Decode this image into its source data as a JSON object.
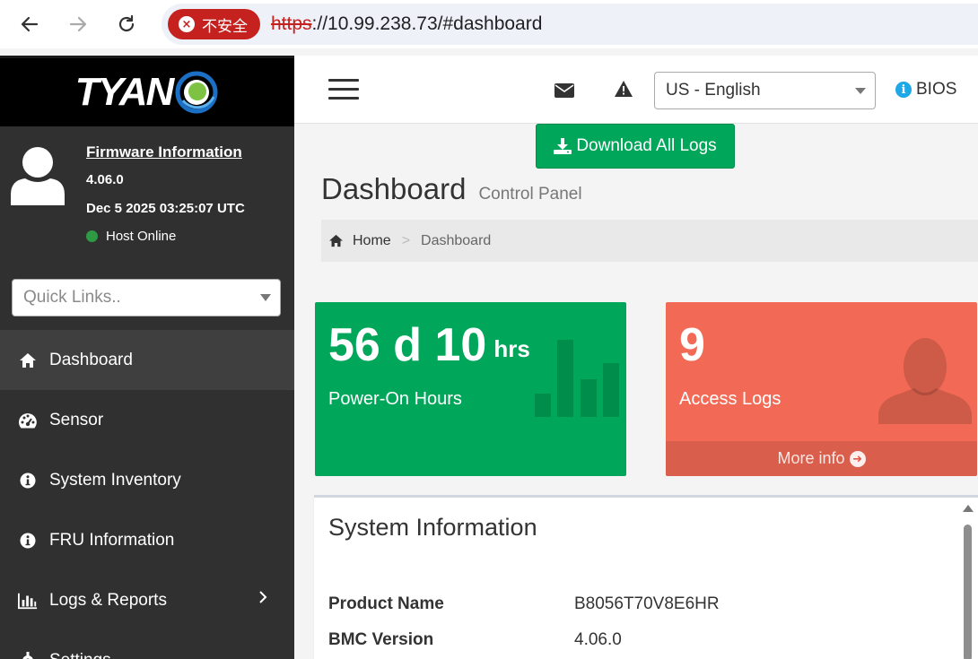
{
  "browser": {
    "security_label": "不安全",
    "url_scheme": "https",
    "url_rest": "://10.99.238.73/#dashboard"
  },
  "sidebar": {
    "logo_text": "TYAN",
    "firmware_link": "Firmware Information",
    "firmware_version": "4.06.0",
    "firmware_date": "Dec 5 2025 03:25:07 UTC",
    "host_status": "Host Online",
    "host_status_color": "#2e9a44",
    "quick_links_placeholder": "Quick Links..",
    "items": [
      {
        "label": "Dashboard",
        "icon": "home-icon",
        "active": true
      },
      {
        "label": "Sensor",
        "icon": "dashboard-gauge-icon"
      },
      {
        "label": "System Inventory",
        "icon": "info-circle-icon"
      },
      {
        "label": "FRU Information",
        "icon": "info-circle-icon"
      },
      {
        "label": "Logs & Reports",
        "icon": "bar-chart-icon",
        "has_submenu": true
      },
      {
        "label": "Settings",
        "icon": "gear-icon"
      }
    ]
  },
  "header": {
    "language": "US - English",
    "bios_label": "BIOS"
  },
  "content": {
    "download_button": "Download All Logs",
    "page_title": "Dashboard",
    "page_subtitle": "Control Panel",
    "breadcrumb_home": "Home",
    "breadcrumb_separator": ">",
    "breadcrumb_current": "Dashboard"
  },
  "tiles": {
    "power_on": {
      "value": "56 d 10",
      "unit": "hrs",
      "label": "Power-On Hours",
      "color": "#00a65a"
    },
    "access_logs": {
      "value": "9",
      "label": "Access Logs",
      "footer": "More info",
      "color": "#f26a55"
    }
  },
  "system_info": {
    "title": "System Information",
    "rows": [
      {
        "key": "Product Name",
        "value": "B8056T70V8E6HR"
      },
      {
        "key": "BMC Version",
        "value": "4.06.0"
      }
    ]
  }
}
